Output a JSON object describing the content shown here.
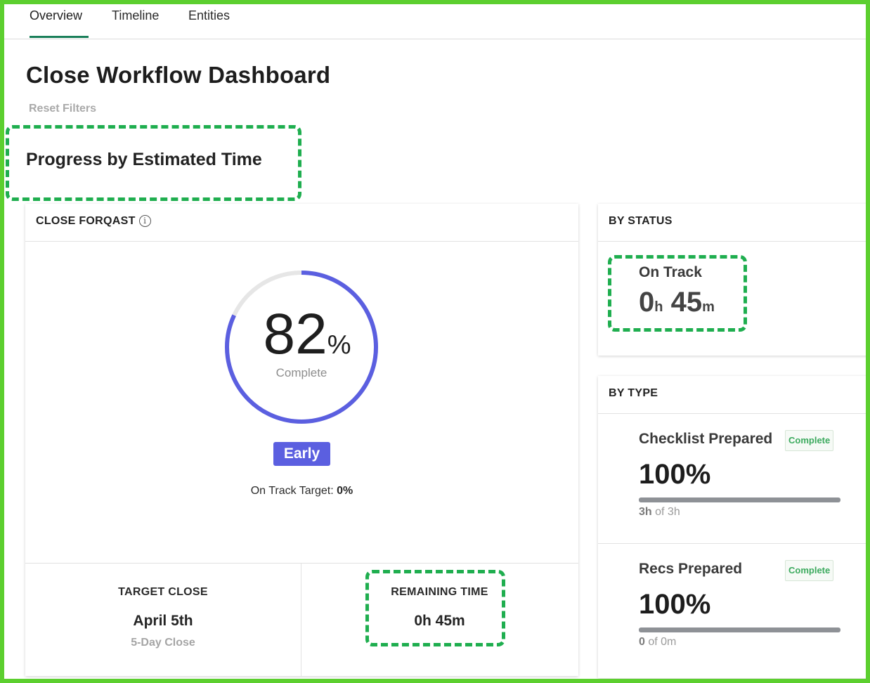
{
  "tabs": [
    {
      "label": "Overview",
      "active": true
    },
    {
      "label": "Timeline",
      "active": false
    },
    {
      "label": "Entities",
      "active": false
    }
  ],
  "page_title": "Close Workflow Dashboard",
  "reset_filters": "Reset Filters",
  "section_title": "Progress by Estimated Time",
  "forecast": {
    "title": "CLOSE FORQAST",
    "info_icon": "info-icon",
    "percent_complete": 82,
    "percent_number": "82",
    "percent_sign": "%",
    "complete_label": "Complete",
    "badge": "Early",
    "on_track_target_label": "On Track Target:",
    "on_track_target_value": "0%",
    "target_close": {
      "label": "TARGET CLOSE",
      "value": "April 5th",
      "sub": "5-Day Close"
    },
    "remaining_time": {
      "label": "REMAINING TIME",
      "value": "0h 45m"
    }
  },
  "by_status": {
    "title": "BY STATUS",
    "status_label": "On Track",
    "hours": "0",
    "hours_unit": "h",
    "minutes": "45",
    "minutes_unit": "m"
  },
  "by_type": {
    "title": "BY TYPE",
    "items": [
      {
        "name": "Checklist Prepared",
        "badge": "Complete",
        "percent": "100%",
        "progress": 1.0,
        "done": "3h",
        "of_label": "of",
        "total": "3h"
      },
      {
        "name": "Recs Prepared",
        "badge": "Complete",
        "percent": "100%",
        "progress": 1.0,
        "done": "0",
        "of_label": "of",
        "total": "0m"
      }
    ]
  },
  "colors": {
    "ring": "#5b5fe0",
    "ring_track": "#e6e6e6",
    "badge": "#5b5fe0",
    "tab_underline": "#1a7f5a",
    "highlight": "#1fae4f",
    "frame": "#5ccf2f"
  }
}
